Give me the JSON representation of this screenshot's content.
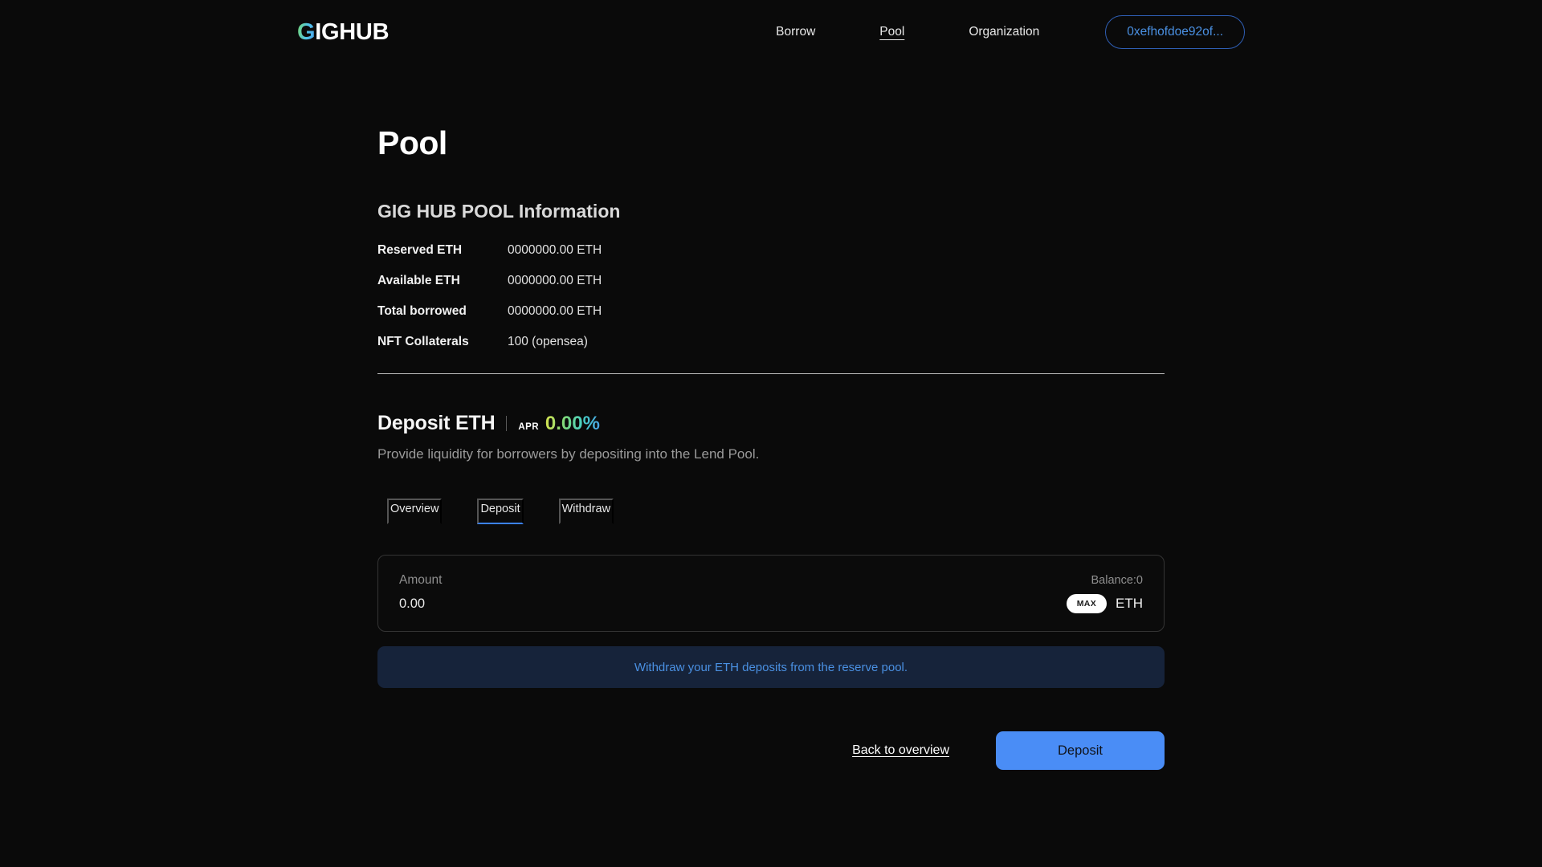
{
  "header": {
    "logo": {
      "accent_letter": "G",
      "rest": "IGHUB",
      "accent_from": "#79d96a",
      "accent_to": "#4a9ee8"
    },
    "nav": [
      {
        "label": "Borrow",
        "active": false
      },
      {
        "label": "Pool",
        "active": true
      },
      {
        "label": "Organization",
        "active": false
      }
    ],
    "wallet": {
      "label": "0xefhofdoe92of...",
      "border_color": "#2f5fb5",
      "text_color": "#4a90e2"
    }
  },
  "main": {
    "page_title": "Pool",
    "info_section": {
      "title": "GIG HUB POOL Information",
      "rows": [
        {
          "label": "Reserved ETH",
          "value": "0000000.00 ETH"
        },
        {
          "label": "Available ETH",
          "value": "0000000.00 ETH"
        },
        {
          "label": "Total borrowed",
          "value": "0000000.00 ETH"
        },
        {
          "label": "NFT Collaterals",
          "value": "100 (opensea)"
        }
      ]
    },
    "deposit": {
      "title": "Deposit ETH",
      "apr_label": "APR",
      "apr_value": "0.00%",
      "subtitle": "Provide liquidity for borrowers by depositing into the Lend Pool.",
      "tabs": [
        {
          "label": "Overview",
          "active": false
        },
        {
          "label": "Deposit",
          "active": true
        },
        {
          "label": "Withdraw",
          "active": false
        }
      ],
      "amount_field": {
        "label": "Amount",
        "value": "0.00",
        "placeholder": "0.00",
        "balance": "Balance:0",
        "max_label": "MAX",
        "unit": "ETH"
      },
      "notice": {
        "text": "Withdraw your ETH deposits from the reserve pool.",
        "bg": "#16233a",
        "color": "#4a90e2"
      },
      "actions": {
        "back_label": "Back to overview",
        "primary_label": "Deposit",
        "primary_color": "#4a8df6"
      }
    }
  }
}
